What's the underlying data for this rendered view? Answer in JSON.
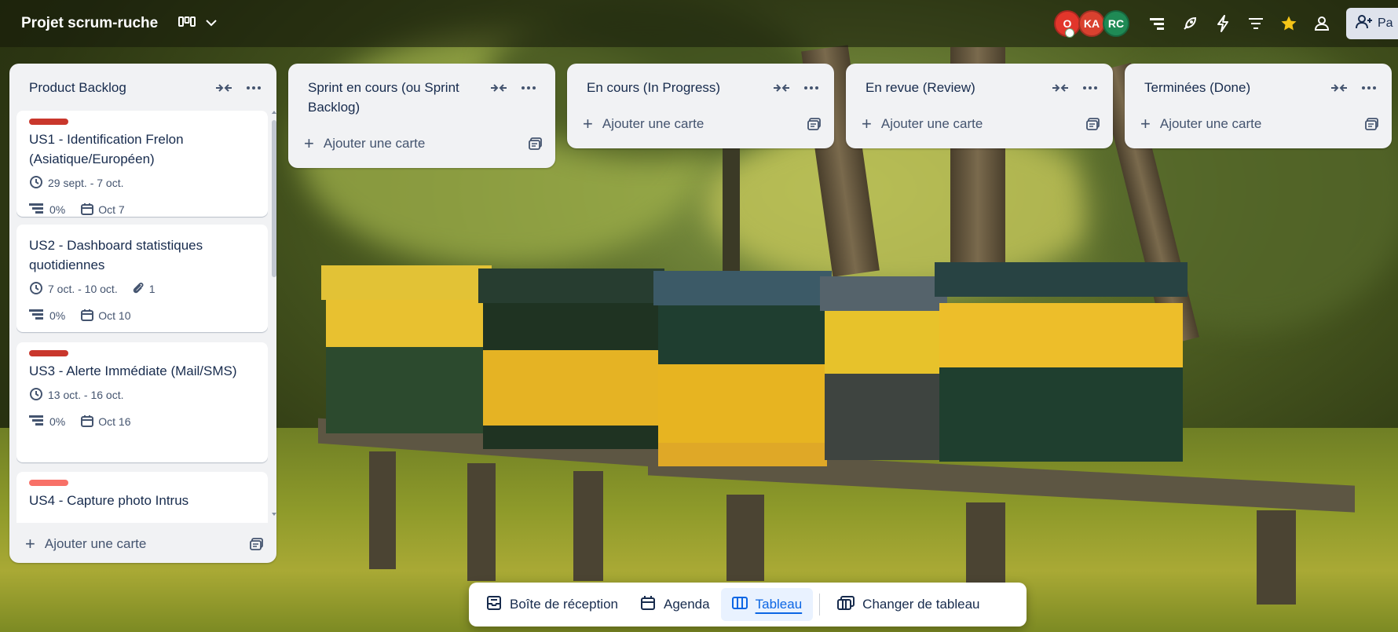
{
  "board": {
    "title": "Projet scrum-ruche"
  },
  "topbar": {
    "view_icon": "board-view-icon",
    "avatars": [
      {
        "initials": "O",
        "color": "#e2362b"
      },
      {
        "initials": "KA",
        "color": "#d9412f"
      },
      {
        "initials": "RC",
        "color": "#1f8a55"
      }
    ],
    "share_label": "Pa",
    "accent_star_color": "#f5c518"
  },
  "lists": [
    {
      "title": "Product Backlog",
      "add_label": "Ajouter une carte",
      "cards": [
        {
          "title": "US1 - Identification Frelon (Asiatique/Européen)",
          "label_color": "#c9372c",
          "dates": "29 sept. - 7 oct.",
          "checklist": "0%",
          "due": "Oct 7"
        },
        {
          "title": "US2 - Dashboard statistiques quotidiennes",
          "dates": "7 oct. - 10 oct.",
          "attachments": "1",
          "checklist": "0%",
          "due": "Oct 10"
        },
        {
          "title": "US3 - Alerte Immédiate (Mail/SMS)",
          "label_color": "#c9372c",
          "dates": "13 oct. - 16 oct.",
          "checklist": "0%",
          "due": "Oct 16"
        },
        {
          "title": "US4 - Capture photo Intrus",
          "label_color": "#f87168"
        }
      ]
    },
    {
      "title": "Sprint en cours (ou Sprint Backlog)",
      "add_label": "Ajouter une carte"
    },
    {
      "title": "En cours (In Progress)",
      "add_label": "Ajouter une carte"
    },
    {
      "title": "En revue (Review)",
      "add_label": "Ajouter une carte"
    },
    {
      "title": "Terminées (Done)",
      "add_label": "Ajouter une carte"
    }
  ],
  "bottom_nav": {
    "inbox": "Boîte de réception",
    "planner": "Agenda",
    "board": "Tableau",
    "switch": "Changer de tableau"
  }
}
